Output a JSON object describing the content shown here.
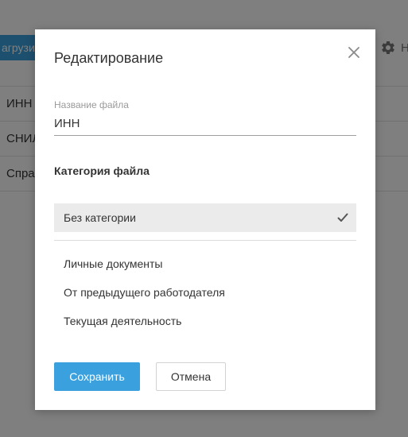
{
  "background": {
    "upload_button_label": "агрузит",
    "settings_label": "Н",
    "rows": [
      "ИНН",
      "СНИЛ",
      "Спра"
    ]
  },
  "modal": {
    "title": "Редактирование",
    "file_name_label": "Название файла",
    "file_name_value": "ИНН",
    "category_title": "Категория файла",
    "selected_category": "Без категории",
    "categories": [
      "Личные документы",
      "От предыдущего работодателя",
      "Текущая деятельность"
    ],
    "save_label": "Сохранить",
    "cancel_label": "Отмена"
  },
  "colors": {
    "accent": "#3aa0de",
    "overlay": "rgba(0,0,0,0.5)",
    "selected_bg": "#ebebeb"
  },
  "icons": {
    "close": "close-icon",
    "check": "check-icon",
    "settings": "gear-icon"
  }
}
